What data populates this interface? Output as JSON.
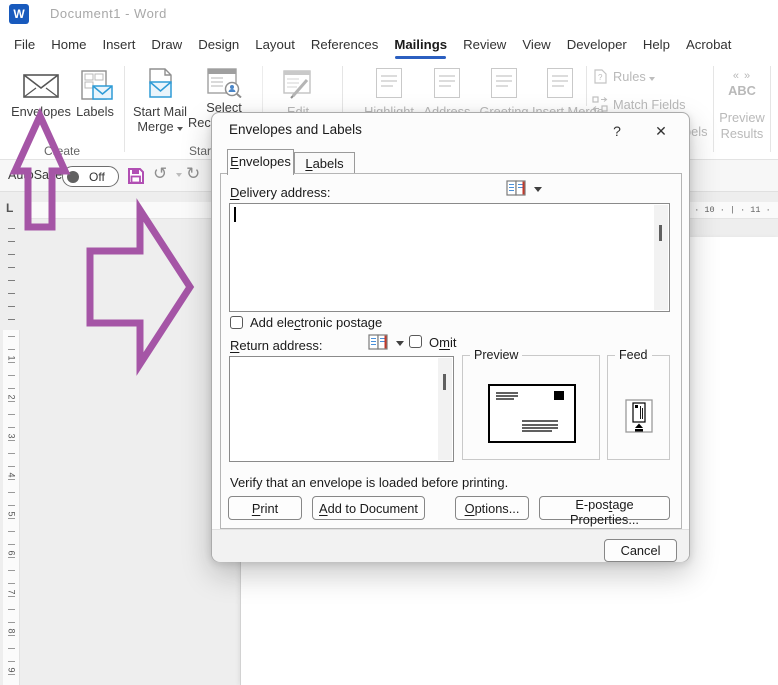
{
  "title_bar": {
    "app_icon_letter": "W",
    "title": "Document1  -  Word"
  },
  "menu": {
    "tabs": [
      {
        "label": "File"
      },
      {
        "label": "Home"
      },
      {
        "label": "Insert"
      },
      {
        "label": "Draw"
      },
      {
        "label": "Design"
      },
      {
        "label": "Layout"
      },
      {
        "label": "References"
      },
      {
        "label": "Mailings",
        "active": true
      },
      {
        "label": "Review"
      },
      {
        "label": "View"
      },
      {
        "label": "Developer"
      },
      {
        "label": "Help"
      },
      {
        "label": "Acrobat"
      }
    ]
  },
  "ribbon": {
    "envelopes": "Envelopes",
    "labels": "Labels",
    "create_group": "Create",
    "start_mail_merge_line1": "Start Mail",
    "start_mail_merge_line2": "Merge",
    "select_recipients_line1": "Select",
    "select_recipients_line2": "Recipients",
    "start_group": "Start Mail Merge",
    "edit": "Edit",
    "highlight": "Highlight",
    "address": "Address",
    "greeting": "Greeting",
    "insert_merge": "Insert Merge",
    "rules": "Rules",
    "match_fields": "Match Fields",
    "update_labels": "Update Labels",
    "preview_chevrons": "« »",
    "preview_abc": "ABC",
    "preview_line1": "Preview",
    "preview_line2": "Results"
  },
  "qat": {
    "autosave": "AutoSave",
    "toggle": "Off",
    "undo": "↺",
    "redo": "↻"
  },
  "rulers": {
    "tab_selector": "L",
    "horizontal_marks": "| · 10 · | · 11 · | ·",
    "vertical_numbers": [
      "1",
      "2",
      "3",
      "4",
      "5",
      "6",
      "7",
      "8",
      "9"
    ]
  },
  "dialog": {
    "title": "Envelopes and Labels",
    "help": "?",
    "close": "✕",
    "tab_envelopes": {
      "pre": "",
      "accel": "E",
      "post": "nvelopes"
    },
    "tab_labels": {
      "pre": "",
      "accel": "L",
      "post": "abels"
    },
    "delivery_label": {
      "pre": "",
      "accel": "D",
      "post": "elivery address:"
    },
    "add_postage": {
      "pre": "Add ele",
      "accel": "c",
      "post": "tronic postage"
    },
    "return_label": {
      "pre": "",
      "accel": "R",
      "post": "eturn address:"
    },
    "omit": {
      "pre": "O",
      "accel": "m",
      "post": "it"
    },
    "preview_group": "Preview",
    "feed_group": "Feed",
    "verify_text": "Verify that an envelope is loaded before printing.",
    "print": {
      "pre": "",
      "accel": "P",
      "post": "rint"
    },
    "add_to_document": {
      "pre": "",
      "accel": "A",
      "post": "dd to Document"
    },
    "options": {
      "pre": "",
      "accel": "O",
      "post": "ptions..."
    },
    "epostage": {
      "pre": "E-pos",
      "accel": "t",
      "post": "age Properties..."
    },
    "cancel": "Cancel"
  },
  "colors": {
    "accent_blue": "#2b5fc0",
    "annotation_purple": "#a555a6",
    "envelope_blue": "#2e9bd6",
    "title_gray": "#a8a8a8"
  }
}
